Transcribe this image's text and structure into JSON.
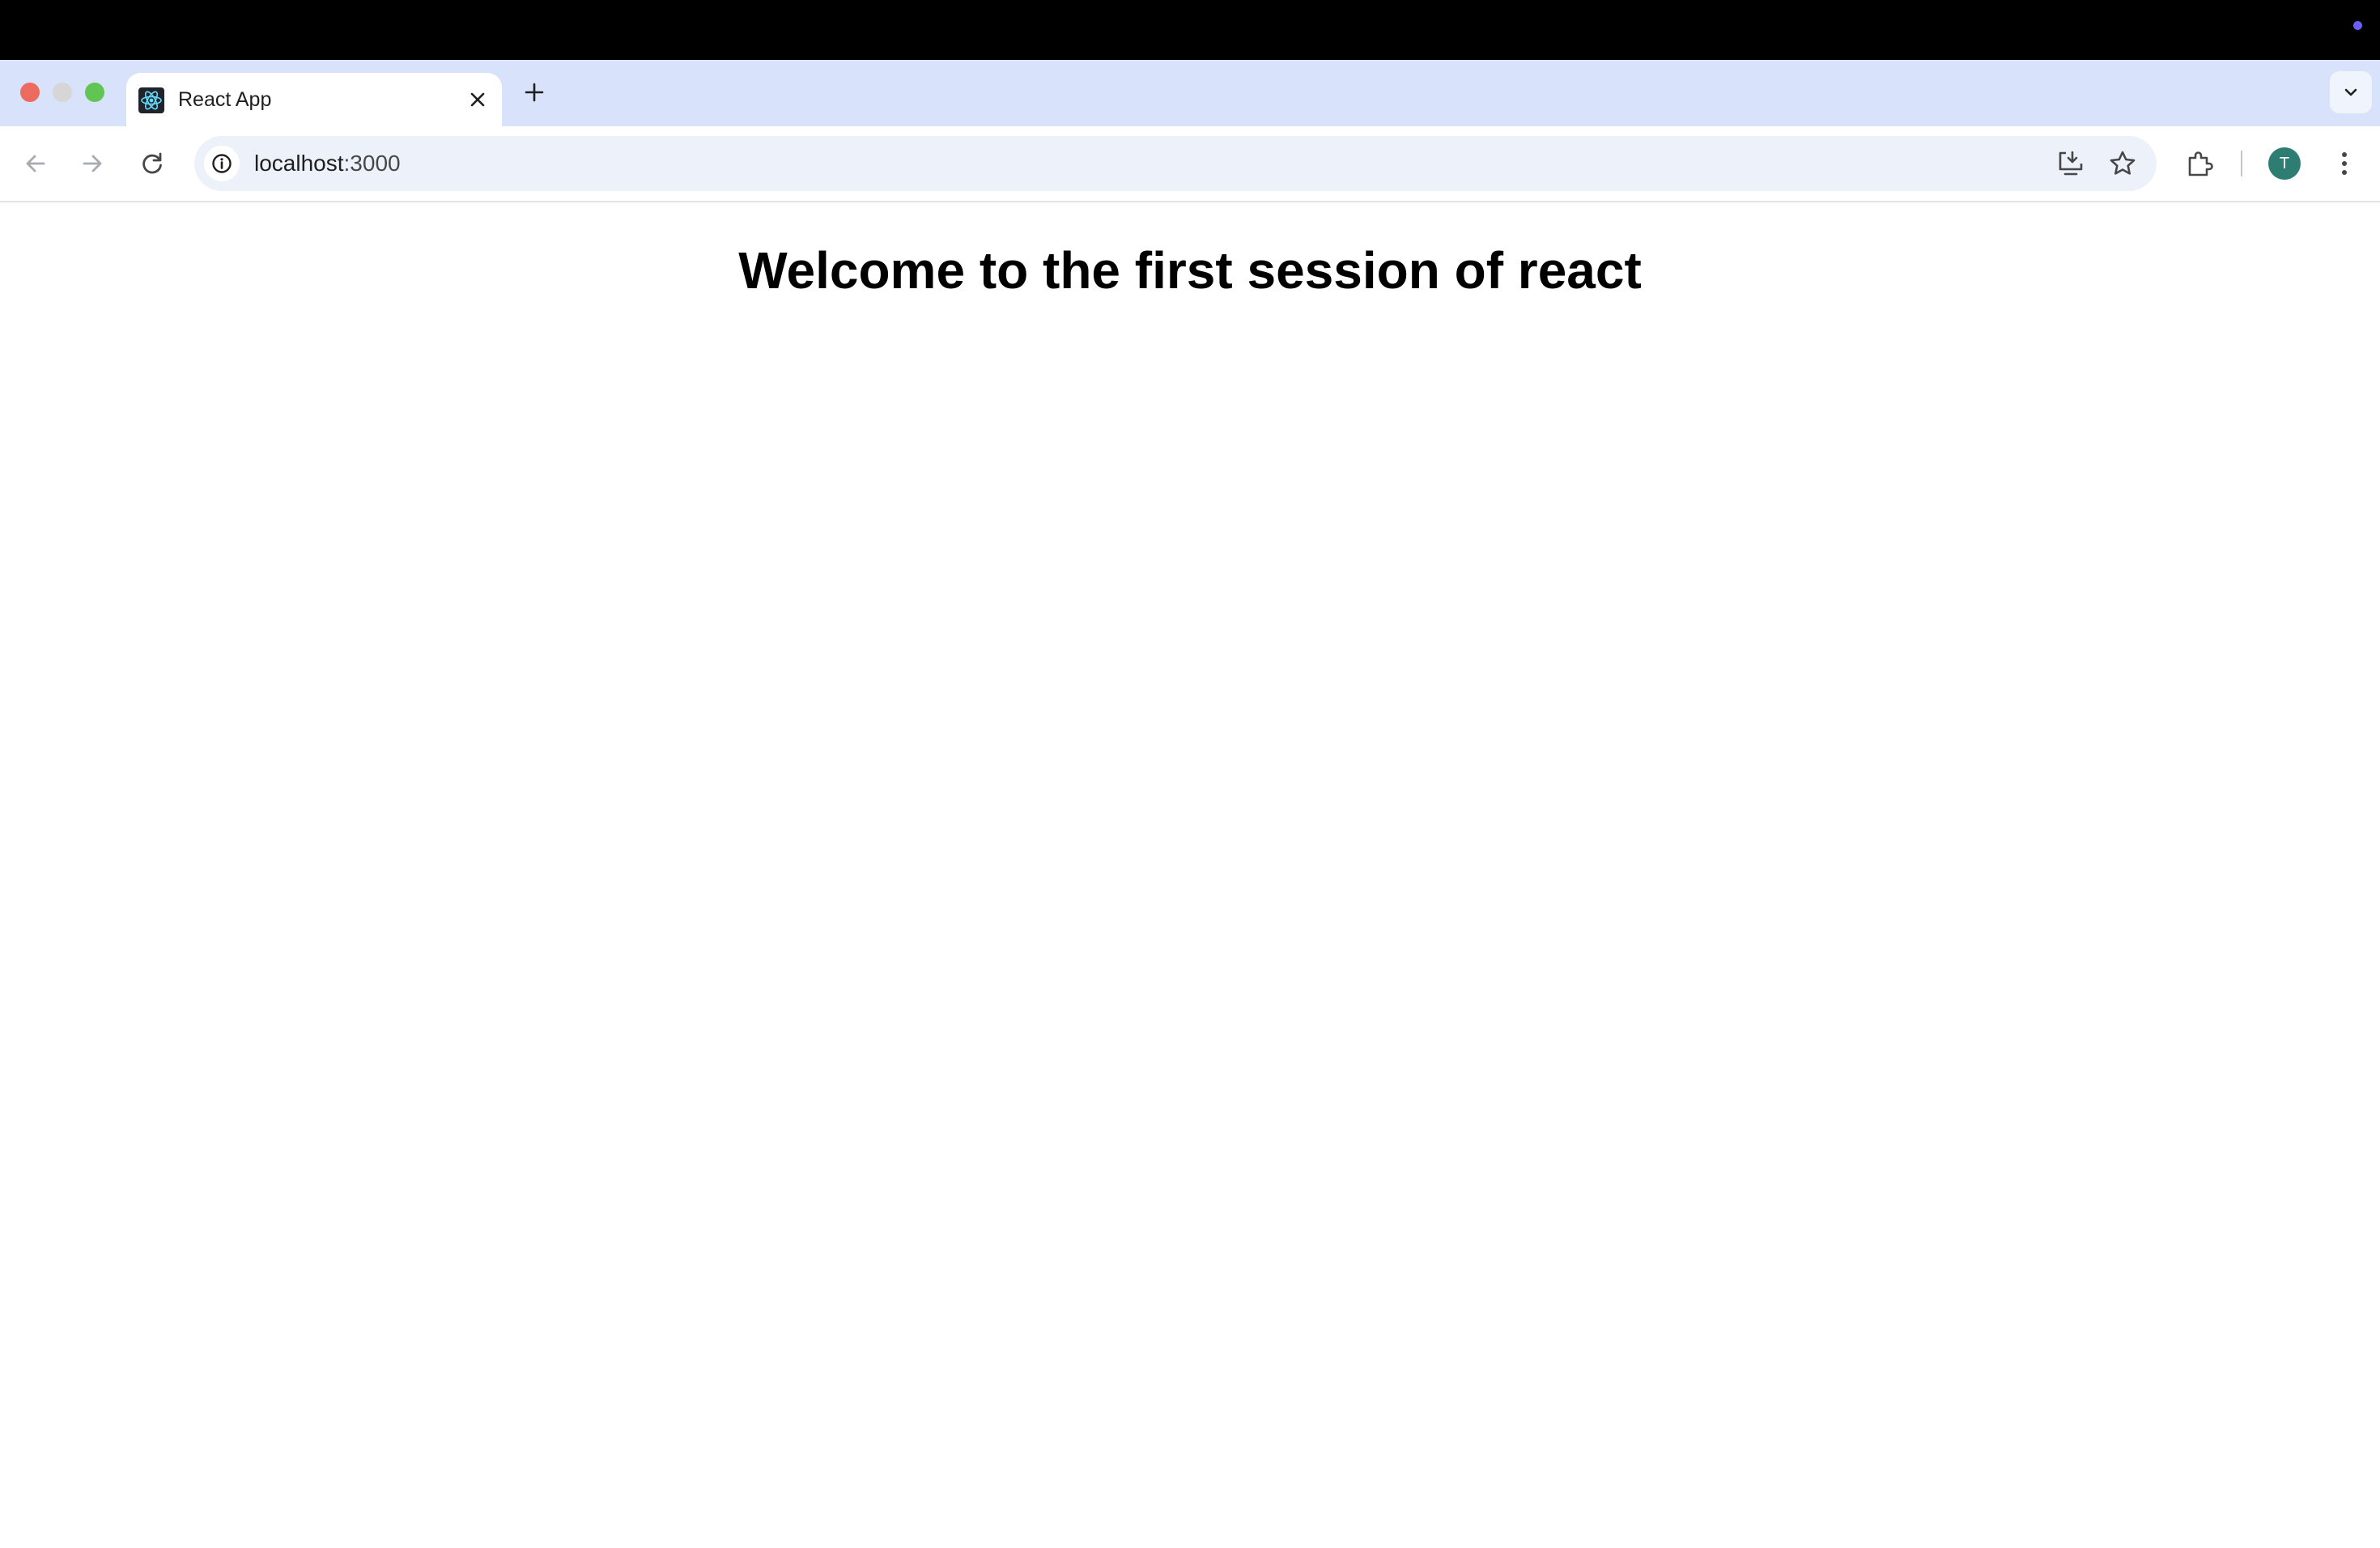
{
  "browser": {
    "tab": {
      "title": "React App"
    },
    "address_bar": {
      "host": "localhost",
      "port": ":3000"
    },
    "profile": {
      "initial": "T",
      "color": "#2e7d72"
    },
    "icons": {
      "favicon": "react-logo-icon",
      "close": "close-icon",
      "new_tab": "plus-icon",
      "tab_search": "chevron-down-icon",
      "back": "arrow-left-icon",
      "forward": "arrow-right-icon",
      "reload": "reload-icon",
      "site_info": "info-icon",
      "install": "install-app-icon",
      "bookmark": "star-icon",
      "extensions": "puzzle-icon",
      "menu": "kebab-menu-icon"
    },
    "colors": {
      "tabstrip": "#d8e3fb",
      "omnibox": "#edf2fa",
      "menubar": "#000000"
    }
  },
  "page": {
    "heading": "Welcome to the first session of react"
  }
}
